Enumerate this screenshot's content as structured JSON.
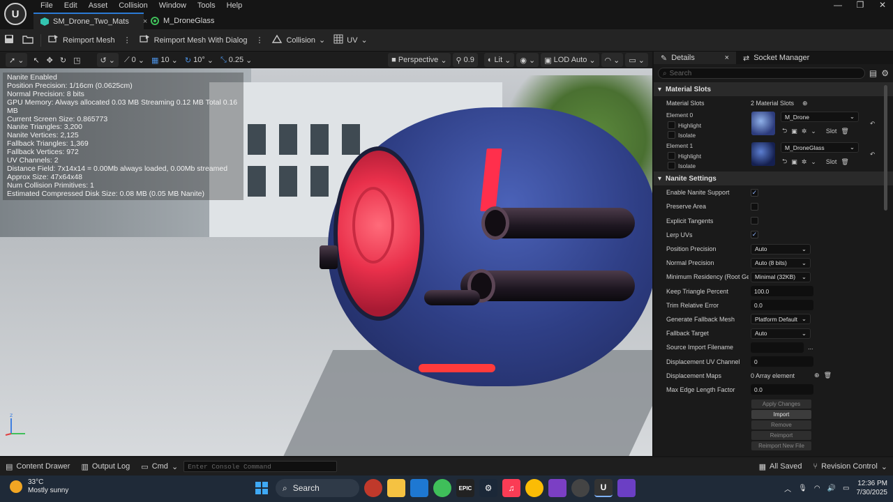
{
  "menu": [
    "File",
    "Edit",
    "Asset",
    "Collision",
    "Window",
    "Tools",
    "Help"
  ],
  "tabs": [
    {
      "label": "SM_Drone_Two_Mats",
      "close": "×"
    },
    {
      "label": "M_DroneGlass"
    }
  ],
  "toolbar": {
    "reimport": "Reimport Mesh",
    "reimport_dialog": "Reimport Mesh With Dialog",
    "collision": "Collision",
    "uv": "UV"
  },
  "viewport_toolbar": {
    "rot_snap": "0",
    "grid_snap": "10",
    "angle_snap": "10°",
    "scale_snap": "0.25",
    "view_mode": "Perspective",
    "fov": "0.9",
    "lighting": "Lit",
    "lod": "LOD Auto"
  },
  "stats": [
    "Nanite Enabled",
    "Position Precision: 1/16cm (0.0625cm)",
    "Normal Precision: 8 bits",
    "GPU Memory: Always allocated 0.03 MB  Streaming 0.12 MB  Total 0.16 MB",
    "Current Screen Size: 0.865773",
    "Nanite Triangles: 3,200",
    "Nanite Vertices: 2,125",
    "Fallback Triangles: 1,369",
    "Fallback Vertices: 972",
    "UV Channels: 2",
    "Distance Field: 7x14x14 = 0.00Mb always loaded, 0.00Mb streamed",
    "Approx Size: 47x64x48",
    "Num Collision Primitives: 1",
    "Estimated Compressed Disk Size: 0.08 MB (0.05 MB Nanite)"
  ],
  "details": {
    "tab_details": "Details",
    "tab_details_close": "×",
    "tab_socket": "Socket Manager",
    "search_placeholder": "Search",
    "material_slots": {
      "header": "Material Slots",
      "label": "Material Slots",
      "count": "2 Material Slots",
      "elements": [
        {
          "label": "Element 0",
          "highlight": "Highlight",
          "isolate": "Isolate",
          "material": "M_Drone",
          "slot": "Slot"
        },
        {
          "label": "Element 1",
          "highlight": "Highlight",
          "isolate": "Isolate",
          "material": "M_DroneGlass",
          "slot": "Slot"
        }
      ]
    },
    "nanite": {
      "header": "Nanite Settings",
      "enable_nanite": "Enable Nanite Support",
      "preserve_area": "Preserve Area",
      "explicit_tangents": "Explicit Tangents",
      "lerp_uvs": "Lerp UVs",
      "position_precision": "Position Precision",
      "position_precision_val": "Auto",
      "normal_precision": "Normal Precision",
      "normal_precision_val": "Auto (8 bits)",
      "min_residency": "Minimum Residency (Root Geom",
      "min_residency_val": "Minimal (32KB)",
      "keep_triangle": "Keep Triangle Percent",
      "keep_triangle_val": "100.0",
      "trim_error": "Trim Relative Error",
      "trim_error_val": "0.0",
      "gen_fallback": "Generate Fallback Mesh",
      "gen_fallback_val": "Platform Default",
      "fallback_target": "Fallback Target",
      "fallback_target_val": "Auto",
      "source_import": "Source Import Filename",
      "source_import_more": "...",
      "displacement_uv": "Displacement UV Channel",
      "displacement_uv_val": "0",
      "displacement_maps": "Displacement Maps",
      "displacement_maps_val": "0 Array element",
      "max_edge": "Max Edge Length Factor",
      "max_edge_val": "0.0"
    },
    "buttons": {
      "apply": "Apply Changes",
      "import": "Import",
      "remove": "Remove",
      "reimport": "Reimport",
      "reimport_new": "Reimport New File"
    }
  },
  "bottombar": {
    "content_drawer": "Content Drawer",
    "output_log": "Output Log",
    "cmd": "Cmd",
    "console_placeholder": "Enter Console Command",
    "all_saved": "All Saved",
    "revision": "Revision Control"
  },
  "taskbar": {
    "temp": "33°C",
    "weather": "Mostly sunny",
    "search": "Search",
    "time": "12:36 PM",
    "date": "7/30/2025"
  },
  "colors": {
    "accent": "#2b7bd6",
    "drone_blue": "#2f3f86",
    "drone_red": "#ff2f4c"
  }
}
